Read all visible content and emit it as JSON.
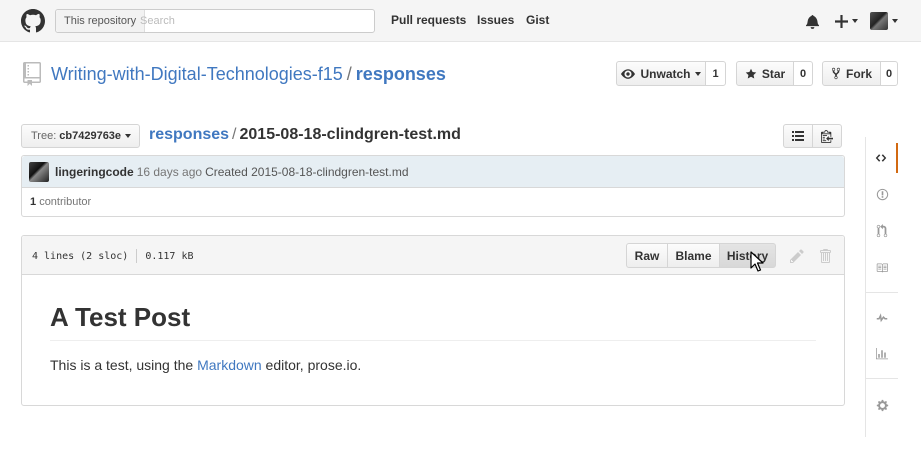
{
  "header": {
    "search_scope": "This repository",
    "search_placeholder": "Search",
    "nav": [
      "Pull requests",
      "Issues",
      "Gist"
    ]
  },
  "repo": {
    "owner": "Writing-with-Digital-Technologies-f15",
    "separator": "/",
    "name": "responses",
    "unwatch_label": "Unwatch",
    "watch_count": "1",
    "star_label": "Star",
    "star_count": "0",
    "fork_label": "Fork",
    "fork_count": "0"
  },
  "file_nav": {
    "tree_label": "Tree:",
    "tree_value": "cb7429763e",
    "breadcrumb_repo": "responses",
    "breadcrumb_sep": "/",
    "file_name": "2015-08-18-clindgren-test.md"
  },
  "commit": {
    "author": "lingeringcode",
    "time": "16 days ago",
    "message": "Created 2015-08-18-clindgren-test.md",
    "contributor_count": "1",
    "contributor_label": "contributor"
  },
  "file": {
    "lines": "4 lines (2 sloc)",
    "size": "0.117 kB",
    "raw_label": "Raw",
    "blame_label": "Blame",
    "history_label": "History",
    "heading": "A Test Post",
    "para_before": "This is a test, using the ",
    "para_link": "Markdown",
    "para_after": " editor, prose.io."
  },
  "colors": {
    "link": "#4078c0",
    "active_tab": "#d26911",
    "commit_bg": "#e6eef3"
  }
}
